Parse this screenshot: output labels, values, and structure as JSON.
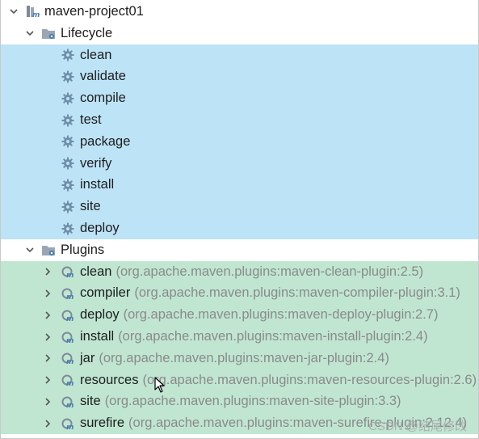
{
  "tree": {
    "project": {
      "label": "maven-project01"
    },
    "lifecycle": {
      "label": "Lifecycle",
      "items": [
        {
          "label": "clean"
        },
        {
          "label": "validate"
        },
        {
          "label": "compile"
        },
        {
          "label": "test"
        },
        {
          "label": "package"
        },
        {
          "label": "verify"
        },
        {
          "label": "install"
        },
        {
          "label": "site"
        },
        {
          "label": "deploy"
        }
      ]
    },
    "plugins": {
      "label": "Plugins",
      "items": [
        {
          "label": "clean",
          "desc": "(org.apache.maven.plugins:maven-clean-plugin:2.5)"
        },
        {
          "label": "compiler",
          "desc": "(org.apache.maven.plugins:maven-compiler-plugin:3.1)"
        },
        {
          "label": "deploy",
          "desc": "(org.apache.maven.plugins:maven-deploy-plugin:2.7)"
        },
        {
          "label": "install",
          "desc": "(org.apache.maven.plugins:maven-install-plugin:2.4)"
        },
        {
          "label": "jar",
          "desc": "(org.apache.maven.plugins:maven-jar-plugin:2.4)"
        },
        {
          "label": "resources",
          "desc": "(org.apache.maven.plugins:maven-resources-plugin:2.6)"
        },
        {
          "label": "site",
          "desc": "(org.apache.maven.plugins:maven-site-plugin:3.3)"
        },
        {
          "label": "surefire",
          "desc": "(org.apache.maven.plugins:maven-surefire-plugin:2.12.4)"
        }
      ]
    }
  },
  "watermark": "CSDN @结尾修改",
  "colors": {
    "lifecycle_bg": "#bde3f7",
    "plugins_bg": "#c0e6d2",
    "gear": "#6f8fa8",
    "plugin_icon": "#4a7fb0"
  }
}
